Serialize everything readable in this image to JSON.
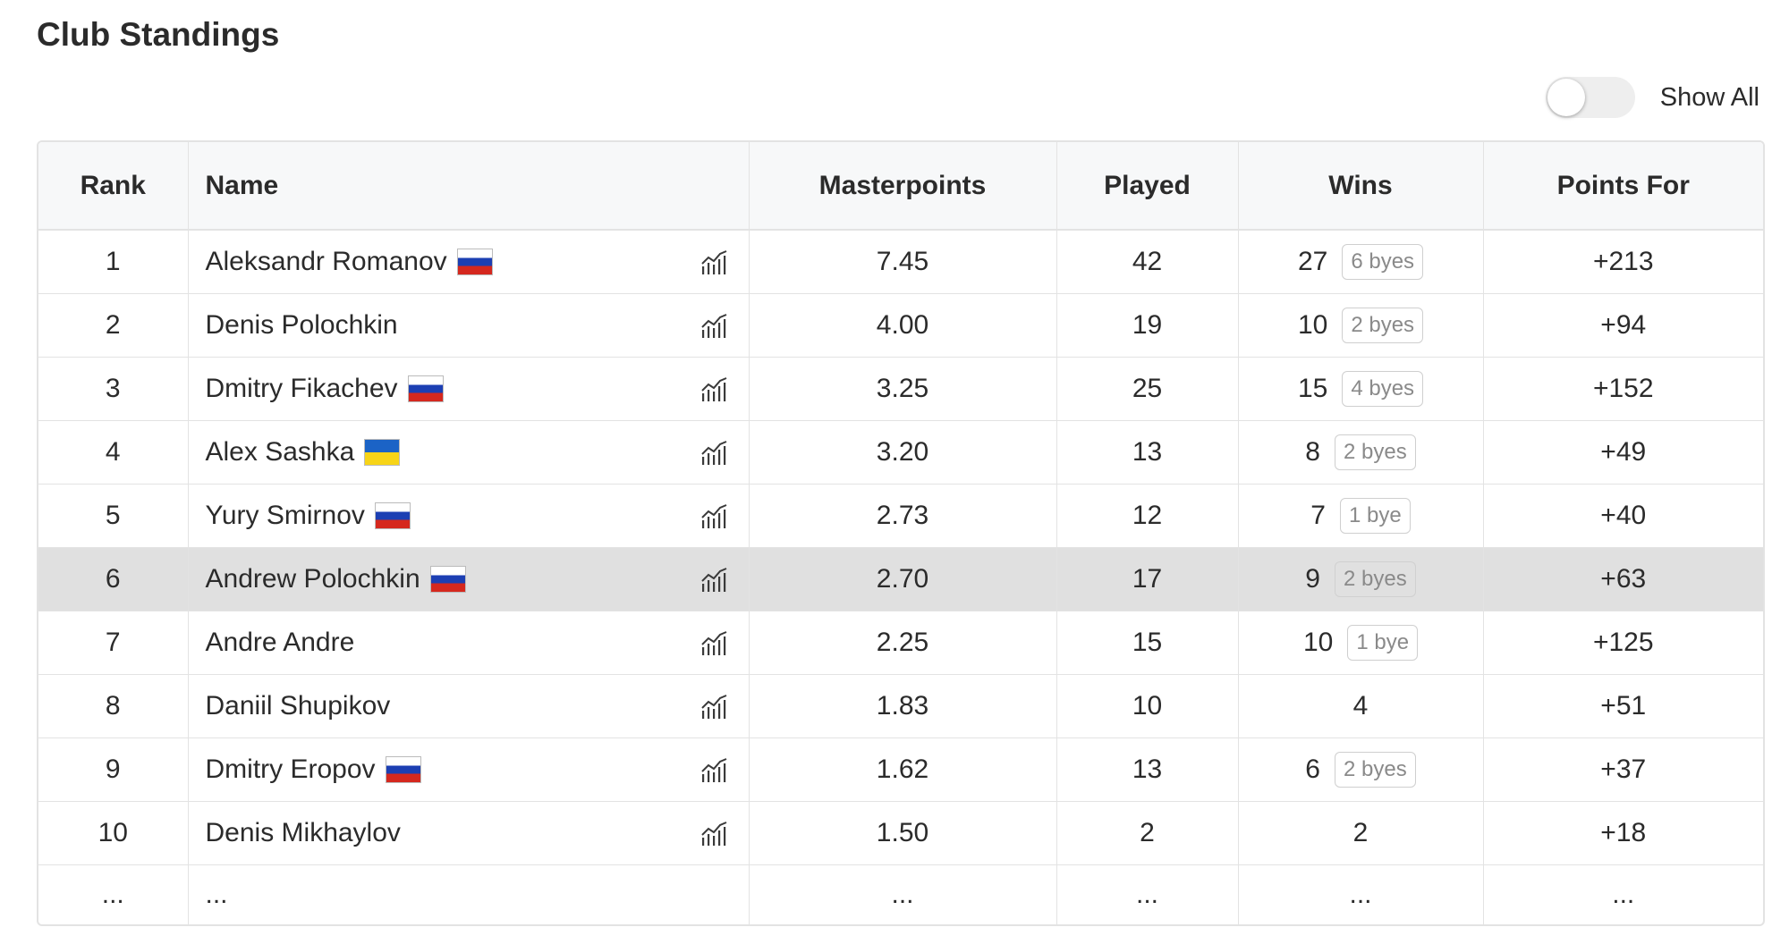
{
  "page": {
    "title": "Club Standings"
  },
  "toggle": {
    "label": "Show All",
    "on": false
  },
  "table": {
    "headers": {
      "rank": "Rank",
      "name": "Name",
      "masterpoints": "Masterpoints",
      "played": "Played",
      "wins": "Wins",
      "points_for": "Points For"
    },
    "rows": [
      {
        "rank": "1",
        "name": "Aleksandr Romanov",
        "flag": "ru",
        "icon": "chart-icon",
        "masterpoints": "7.45",
        "played": "42",
        "wins": "27",
        "byes": "6 byes",
        "points_for": "+213"
      },
      {
        "rank": "2",
        "name": "Denis Polochkin",
        "flag": "",
        "icon": "chart-icon",
        "masterpoints": "4.00",
        "played": "19",
        "wins": "10",
        "byes": "2 byes",
        "points_for": "+94"
      },
      {
        "rank": "3",
        "name": "Dmitry Fikachev",
        "flag": "ru",
        "icon": "chart-icon",
        "masterpoints": "3.25",
        "played": "25",
        "wins": "15",
        "byes": "4 byes",
        "points_for": "+152"
      },
      {
        "rank": "4",
        "name": "Alex Sashka",
        "flag": "ua",
        "icon": "chart-icon",
        "masterpoints": "3.20",
        "played": "13",
        "wins": "8",
        "byes": "2 byes",
        "points_for": "+49"
      },
      {
        "rank": "5",
        "name": "Yury Smirnov",
        "flag": "ru",
        "icon": "chart-icon",
        "masterpoints": "2.73",
        "played": "12",
        "wins": "7",
        "byes": "1 bye",
        "points_for": "+40"
      },
      {
        "rank": "6",
        "name": "Andrew Polochkin",
        "flag": "ru",
        "icon": "chart-icon",
        "masterpoints": "2.70",
        "played": "17",
        "wins": "9",
        "byes": "2 byes",
        "points_for": "+63",
        "highlighted": true
      },
      {
        "rank": "7",
        "name": "Andre Andre",
        "flag": "",
        "icon": "chart-icon",
        "masterpoints": "2.25",
        "played": "15",
        "wins": "10",
        "byes": "1 bye",
        "points_for": "+125"
      },
      {
        "rank": "8",
        "name": "Daniil Shupikov",
        "flag": "",
        "icon": "chart-icon",
        "masterpoints": "1.83",
        "played": "10",
        "wins": "4",
        "byes": "",
        "points_for": "+51"
      },
      {
        "rank": "9",
        "name": "Dmitry Eropov",
        "flag": "ru",
        "icon": "chart-icon",
        "masterpoints": "1.62",
        "played": "13",
        "wins": "6",
        "byes": "2 byes",
        "points_for": "+37"
      },
      {
        "rank": "10",
        "name": "Denis Mikhaylov",
        "flag": "",
        "icon": "chart-icon",
        "masterpoints": "1.50",
        "played": "2",
        "wins": "2",
        "byes": "",
        "points_for": "+18"
      }
    ],
    "ellipsis_row": {
      "rank": "...",
      "name": "...",
      "masterpoints": "...",
      "played": "...",
      "wins": "...",
      "points_for": "..."
    }
  },
  "colors": {
    "highlight_row": "#e0e0e0",
    "header_bg": "#f7f8f9",
    "border": "#e3e3e3",
    "toggle_off": "#eeeeee"
  }
}
